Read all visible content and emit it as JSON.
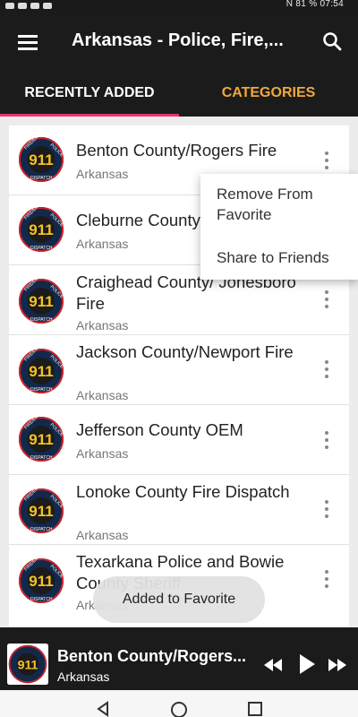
{
  "status_bar": {
    "right_text": "N 81 %  07:54"
  },
  "toolbar": {
    "title": "Arkansas - Police, Fire,..."
  },
  "tabs": [
    {
      "label": "RECENTLY ADDED",
      "active": true
    },
    {
      "label": "CATEGORIES",
      "active": false
    }
  ],
  "logo": {
    "text": "911",
    "ring_text_left": "FIRE/EMS",
    "ring_text_right": "POLICE",
    "ring_text_bottom": "DISPATCH"
  },
  "list": {
    "items": [
      {
        "title": "Benton County/Rogers Fire",
        "subtitle": "Arkansas"
      },
      {
        "title": "Cleburne County",
        "subtitle": "Arkansas"
      },
      {
        "title": "Craighead County/ Jonesboro Fire",
        "subtitle": "Arkansas"
      },
      {
        "title": "Jackson County/Newport Fire",
        "subtitle": "Arkansas"
      },
      {
        "title": "Jefferson County OEM",
        "subtitle": "Arkansas"
      },
      {
        "title": "Lonoke County Fire Dispatch",
        "subtitle": "Arkansas"
      },
      {
        "title": "Texarkana Police and Bowie County Sheriff",
        "subtitle": "Arkansas"
      }
    ]
  },
  "popup_menu": {
    "items": [
      {
        "label": "Remove From Favorite"
      },
      {
        "label": "Share to Friends"
      }
    ]
  },
  "toast": {
    "text": "Added to Favorite"
  },
  "player": {
    "title": "Benton County/Rogers...",
    "subtitle": "Arkansas"
  },
  "colors": {
    "accent_tab": "#f2a83a",
    "indicator": "#e8326e",
    "bar_bg": "#1b1b1b"
  }
}
